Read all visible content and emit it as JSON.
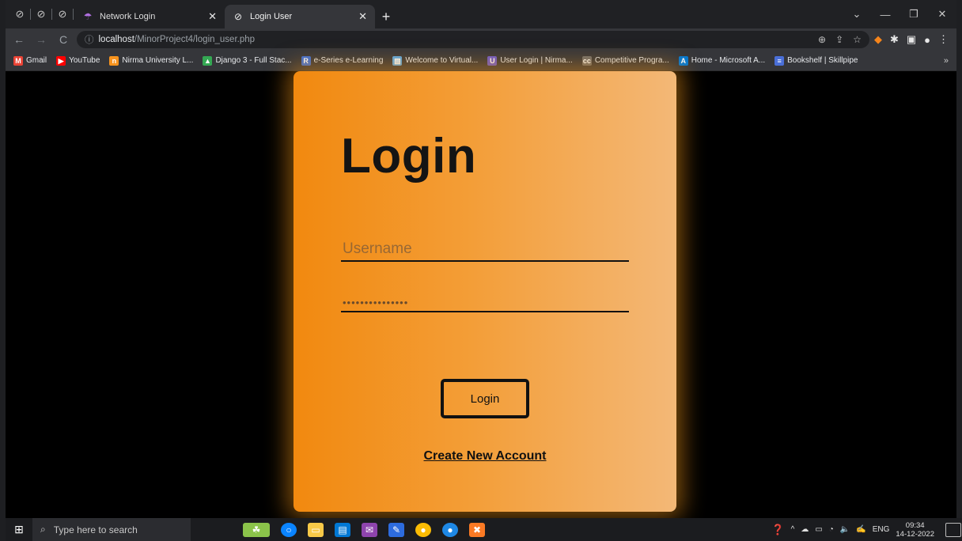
{
  "browser": {
    "tabs": [
      {
        "label": "Network Login",
        "active": false
      },
      {
        "label": "Login User",
        "active": true
      }
    ],
    "pinned_count": 3,
    "url_host": "localhost",
    "url_path": "/MinorProject4/login_user.php",
    "bookmarks": [
      {
        "label": "Gmail",
        "icon": "gmail-icon",
        "color": "#ea4335"
      },
      {
        "label": "YouTube",
        "icon": "youtube-icon",
        "color": "#ff0000"
      },
      {
        "label": "Nirma University L...",
        "icon": "nirma-icon",
        "color": "#f7931e"
      },
      {
        "label": "Django 3 - Full Stac...",
        "icon": "drive-icon",
        "color": "#34a853"
      },
      {
        "label": "e-Series e-Learning",
        "icon": "e-series-icon",
        "color": "#3b6fd8"
      },
      {
        "label": "Welcome to Virtual...",
        "icon": "virtual-icon",
        "color": "#5aa9e6"
      },
      {
        "label": "User Login | Nirma...",
        "icon": "user-login-icon",
        "color": "#6a5acd"
      },
      {
        "label": "Competitive Progra...",
        "icon": "cc-icon",
        "color": "#6f6f6f"
      },
      {
        "label": "Home - Microsoft A...",
        "icon": "azure-icon",
        "color": "#0078d4"
      },
      {
        "label": "Bookshelf | Skillpipe",
        "icon": "bookshelf-icon",
        "color": "#4a6fd8"
      }
    ]
  },
  "page": {
    "title": "Login",
    "username_placeholder": "Username",
    "password_value": "•••••••••••••••",
    "login_button": "Login",
    "create_account_link": "Create New Account"
  },
  "taskbar": {
    "search_placeholder": "Type here to search",
    "language": "ENG",
    "time": "09:34",
    "date": "14-12-2022"
  },
  "colors": {
    "card_start": "#f2890f",
    "card_end": "#f3b877",
    "glow": "#e68c14",
    "background": "#000000"
  }
}
